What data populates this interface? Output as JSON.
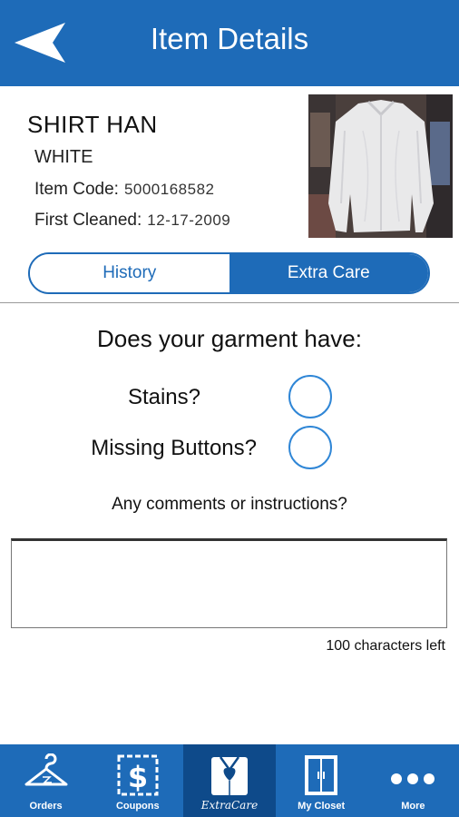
{
  "header": {
    "title": "Item Details",
    "back_icon": "back-arrow-icon"
  },
  "item": {
    "name": "SHIRT HAN",
    "color": "WHITE",
    "code_label": "Item Code:",
    "code_value": "5000168582",
    "cleaned_label": "First Cleaned:",
    "cleaned_value": "12-17-2009",
    "photo": "white-shirt-photo"
  },
  "tabs": [
    {
      "label": "History",
      "selected": false
    },
    {
      "label": "Extra Care",
      "selected": true
    }
  ],
  "form": {
    "question": "Does your garment have:",
    "options": [
      {
        "label": "Stains?",
        "checked": false
      },
      {
        "label": "Missing Buttons?",
        "checked": false
      }
    ],
    "comments_label": "Any comments or instructions?",
    "comments_value": "",
    "chars_left": "100 characters left"
  },
  "nav": [
    {
      "label": "Orders",
      "icon": "hanger-icon",
      "active": false
    },
    {
      "label": "Coupons",
      "icon": "dollar-coupon-icon",
      "active": false
    },
    {
      "label": "ExtraCare",
      "icon": "shirt-heart-icon",
      "active": true
    },
    {
      "label": "My Closet",
      "icon": "closet-icon",
      "active": false
    },
    {
      "label": "More",
      "icon": "more-dots-icon",
      "active": false
    }
  ],
  "colors": {
    "brand_blue": "#1e6bb8",
    "active_nav": "#0e4a8a",
    "radio_border": "#2f86d6"
  }
}
